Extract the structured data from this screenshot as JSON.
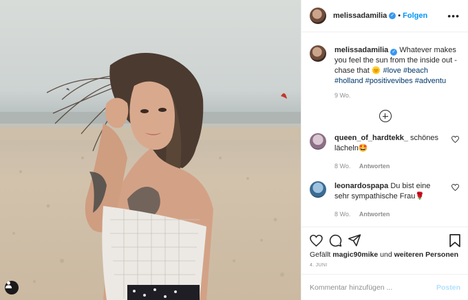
{
  "header": {
    "username": "melissadamilia",
    "separator": "•",
    "follow_label": "Folgen",
    "more_icon": "more-horizontal-icon"
  },
  "caption": {
    "username": "melissadamilia",
    "text": "Whatever makes you feel the sun from the inside out - chase that",
    "emoji": "🌞",
    "hashtags": "#love #beach #holland #positivevibes #adventu",
    "time": "9 Wo."
  },
  "comments": [
    {
      "username": "queen_of_hardtekk_",
      "text": "schönes lächeln",
      "emoji": "🤩",
      "time": "8 Wo.",
      "reply_label": "Antworten"
    },
    {
      "username": "leonardospapa",
      "text": "Du bist eine sehr sympathische Frau",
      "emoji": "🌹",
      "time": "8 Wo.",
      "reply_label": "Antworten"
    }
  ],
  "likes": {
    "prefix": "Gefällt",
    "user": "magic90mike",
    "conjunction": "und",
    "others": "weiteren Personen"
  },
  "post_date": "4. JUNI",
  "add_comment": {
    "placeholder": "Kommentar hinzufügen ...",
    "post_label": "Posten"
  },
  "colors": {
    "accent": "#0095f6",
    "verified": "#3897f0",
    "hashtag": "#00376b",
    "muted": "#8e8e8e",
    "post_disabled": "#b2dffc"
  }
}
